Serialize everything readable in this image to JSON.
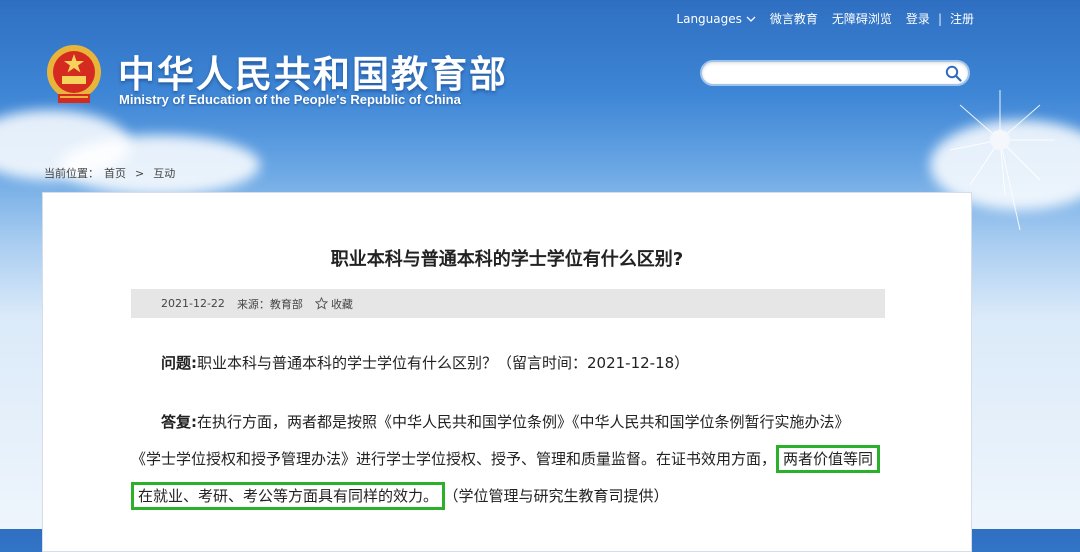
{
  "header": {
    "title_cn": "中华人民共和国教育部",
    "title_en": "Ministry of Education of the People's Republic of China",
    "nav": {
      "languages": "Languages",
      "weibo": "微言教育",
      "accessible": "无障碍浏览",
      "login": "登录",
      "register": "注册"
    },
    "search_placeholder": ""
  },
  "breadcrumb": {
    "prefix": "当前位置：",
    "home": "首页",
    "sep": ">",
    "current": "互动"
  },
  "article": {
    "title": "职业本科与普通本科的学士学位有什么区别?",
    "meta": {
      "date": "2021-12-22",
      "source": "来源：教育部",
      "favorite": "收藏"
    },
    "question": {
      "label": "问题:",
      "text": "职业本科与普通本科的学士学位有什么区别？（留言时间：2021-12-18）"
    },
    "answer": {
      "label": "答复:",
      "line1": "在执行方面，两者都是按照《中华人民共和国学位条例》《中华人民共和国学位条例暂行实施办法》",
      "line2": "《学士学位授权和授予管理办法》进行学士学位授权、授予、管理和质量监督。在证书效用方面，",
      "highlight1": "两者价值等同",
      "highlight2": "在就业、考研、考公等方面具有同样的效力。",
      "tail": "（学位管理与研究生教育司提供）"
    }
  },
  "colors": {
    "highlight_border": "#2bb02b",
    "sky_top": "#2f6fc1"
  }
}
